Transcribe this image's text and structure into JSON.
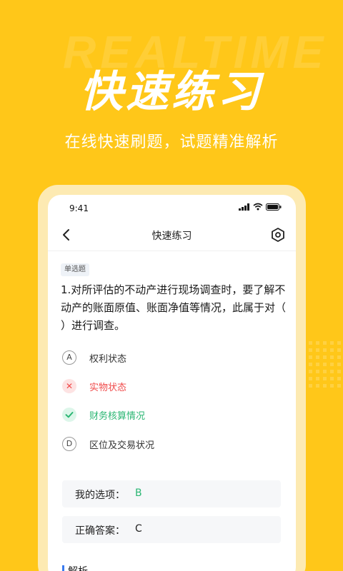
{
  "background": {
    "watermark_text": "REALTIME",
    "brand_color": "#FFC719"
  },
  "hero": {
    "title": "快速练习",
    "subtitle": "在线快速刷题，试题精准解析"
  },
  "phone": {
    "status_bar": {
      "time": "9:41",
      "icons": [
        "signal-icon",
        "wifi-icon",
        "battery-icon"
      ]
    },
    "nav": {
      "title": "快速练习",
      "back_icon": "chevron-left-icon",
      "settings_icon": "hexagon-settings-icon"
    },
    "question": {
      "type_tag": "单选题",
      "text": "1.对所评估的不动产进行现场调查时，要了解不动产的账面原值、账面净值等情况，此属于对（    ）进行调查。",
      "options": [
        {
          "key": "A",
          "text": "权利状态",
          "state": "normal"
        },
        {
          "key": "B",
          "text": "实物状态",
          "state": "wrong"
        },
        {
          "key": "C",
          "text": "财务核算情况",
          "state": "correct"
        },
        {
          "key": "D",
          "text": "区位及交易状况",
          "state": "normal"
        }
      ]
    },
    "my_choice": {
      "label": "我的选项：",
      "value": "B",
      "color": "#2BB673"
    },
    "correct_answer": {
      "label": "正确答案：",
      "value": "C"
    },
    "analysis_label": "解析"
  }
}
